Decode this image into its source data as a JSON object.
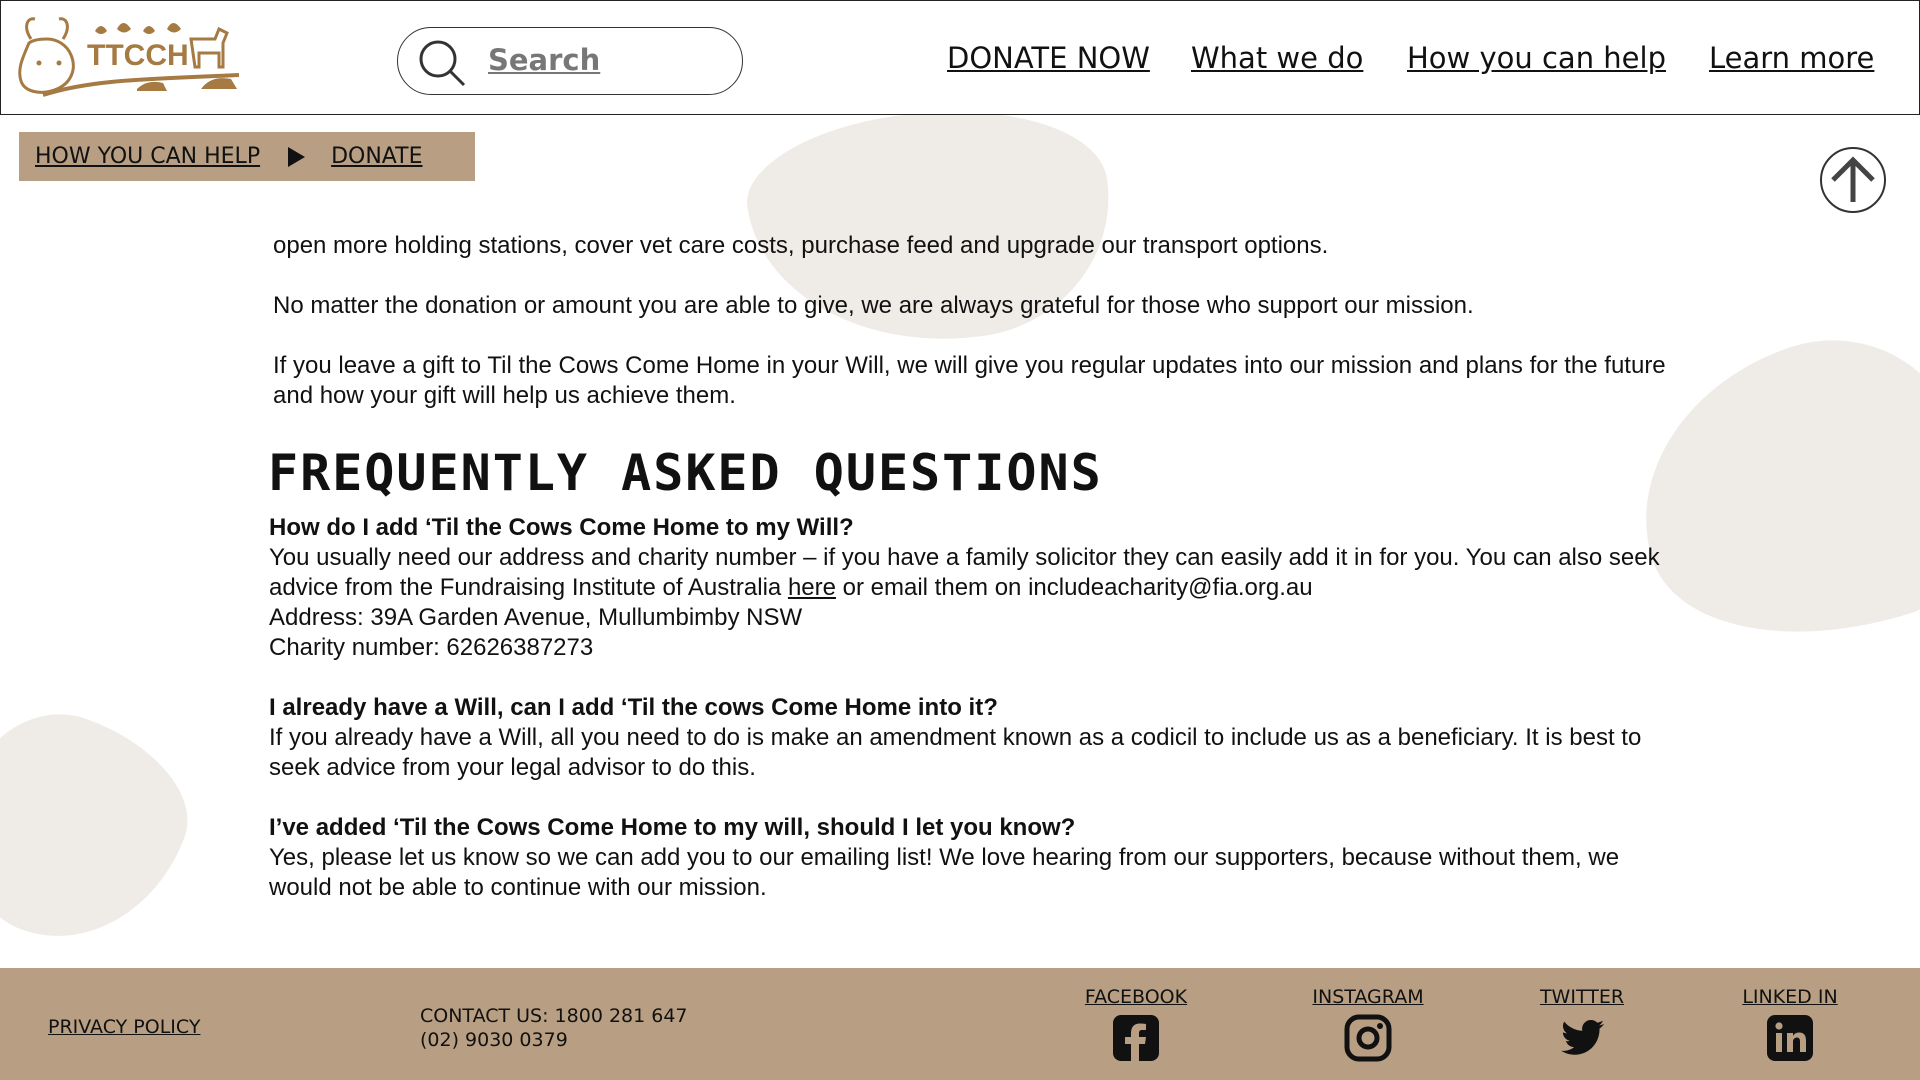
{
  "header": {
    "logo_text": "TTCCH",
    "search_placeholder": "Search",
    "nav": [
      "DONATE NOW",
      "What we do",
      "How you can help",
      "Learn more"
    ]
  },
  "breadcrumb": {
    "items": [
      "HOW YOU CAN HELP",
      "DONATE"
    ]
  },
  "content": {
    "para1": "open more holding stations, cover vet care costs, purchase feed and upgrade our transport options.",
    "para2": "No matter the donation or amount you are able to give, we are always grateful for those who support our mission.",
    "para3": "If you leave a gift to Til the Cows Come Home in your Will, we will give you regular updates into our mission and plans for the future and how your gift will help us achieve them."
  },
  "faq": {
    "title": "FREQUENTLY ASKED QUESTIONS",
    "q1": "How do I add ‘Til the Cows Come Home to my Will?",
    "a1_part1": "You usually need our address and charity number – if you have a family solicitor they can easily add it in for you. You can also seek advice from the Fundraising  Institute of Australia ",
    "a1_link": "here",
    "a1_part2": " or email them on includeacharity@fia.org.au",
    "a1_address": "Address: 39A Garden Avenue, Mullumbimby NSW",
    "a1_charity": "Charity number: 62626387273",
    "q2": "I already have a Will, can I add ‘Til the cows Come Home into it?",
    "a2": "If you already have a Will, all you need to do is make an amendment known as a codicil to include us as a beneficiary. It is best to seek advice from your legal advisor to do this.",
    "q3": "I’ve added ‘Til the Cows Come Home to my will, should I let you know?",
    "a3": "Yes, please let us know so we can add you to our emailing list! We love hearing from our supporters, because without them, we would not be able to continue with our mission."
  },
  "footer": {
    "privacy": "PRIVACY POLICY",
    "contact_line1": "CONTACT US: 1800 281 647",
    "contact_line2": "(02) 9030 0379",
    "social": [
      {
        "label": "FACEBOOK",
        "icon": "facebook-icon"
      },
      {
        "label": "INSTAGRAM",
        "icon": "instagram-icon"
      },
      {
        "label": "TWITTER",
        "icon": "twitter-icon"
      },
      {
        "label": "LINKED IN",
        "icon": "linkedin-icon"
      }
    ]
  },
  "colors": {
    "brand_tan": "#b89f83",
    "blob": "#efebe6",
    "logo_brown": "#a57a43"
  }
}
